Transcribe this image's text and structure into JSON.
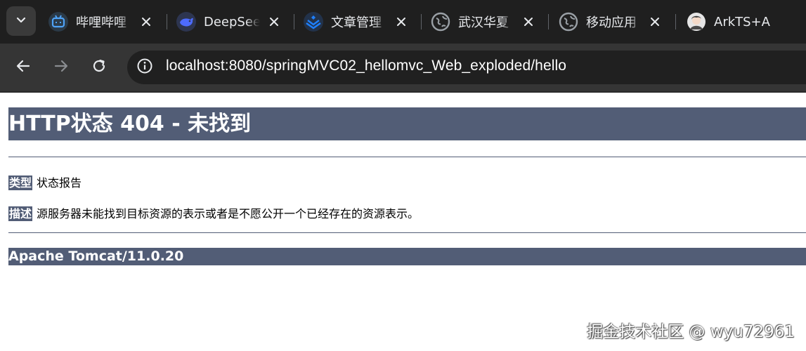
{
  "tabs": [
    {
      "title": "哔哩哔哩",
      "icon": "bilibili-icon",
      "color": "#4fa3f7"
    },
    {
      "title": "DeepSeek",
      "icon": "deepseek-whale-icon",
      "color": "#4d6bfe"
    },
    {
      "title": "文章管理",
      "icon": "juejin-icon",
      "color": "#1e80ff"
    },
    {
      "title": "武汉华夏",
      "icon": "globe-icon",
      "color": "#9aa0a6"
    },
    {
      "title": "移动应用",
      "icon": "globe-icon",
      "color": "#9aa0a6"
    },
    {
      "title": "ArkTS+A",
      "icon": "avatar-icon",
      "color": "#cfcfcf"
    }
  ],
  "toolbar": {
    "url": "localhost:8080/springMVC02_hellomvc_Web_exploded/hello"
  },
  "page": {
    "heading": "HTTP状态 404 - 未找到",
    "type_label": "类型",
    "type_value": "状态报告",
    "desc_label": "描述",
    "desc_value": "源服务器未能找到目标资源的表示或者是不愿公开一个已经存在的资源表示。",
    "footer": "Apache Tomcat/11.0.20",
    "accent_color": "#525d76"
  },
  "watermark": "掘金技术社区 @ wyu72961"
}
